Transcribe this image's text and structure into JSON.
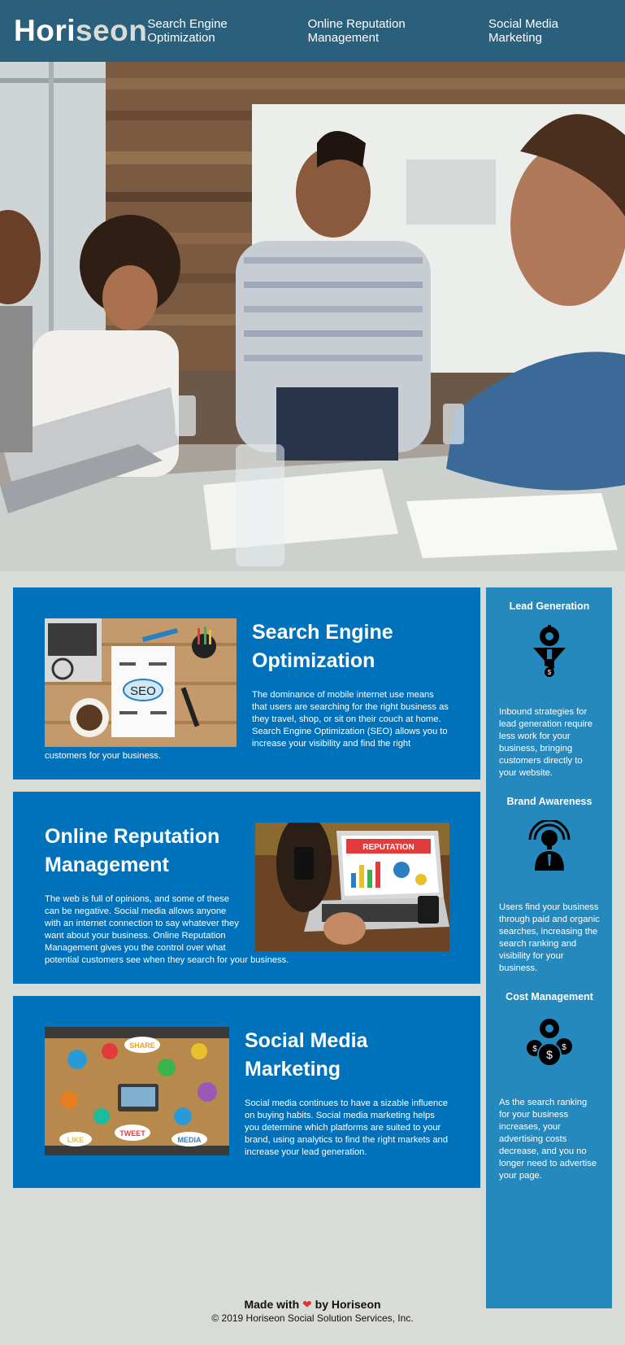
{
  "header": {
    "logo_main": "Hori",
    "logo_accent": "seon",
    "nav": [
      {
        "label": "Search Engine Optimization"
      },
      {
        "label": "Online Reputation Management"
      },
      {
        "label": "Social Media Marketing"
      }
    ]
  },
  "hero": {
    "image": "team-meeting-photo"
  },
  "content": [
    {
      "title": "Search Engine Optimization",
      "text": "The dominance of mobile internet use means that users are searching for the right business as they travel, shop, or sit on their couch at home. Search Engine Optimization (SEO) allows you to increase your visibility and find the right customers for your business.",
      "image": "seo-notebook-image",
      "image_text": "SEO"
    },
    {
      "title": "Online Reputation Management",
      "text": "The web is full of opinions, and some of these can be negative. Social media allows anyone with an internet connection to say whatever they want about your business. Online Reputation Management gives you the control over what potential customers see when they search for your business.",
      "image": "reputation-laptop-image",
      "image_text": "REPUTATION"
    },
    {
      "title": "Social Media Marketing",
      "text": "Social media continues to have a sizable influence on buying habits. Social media marketing helps you determine which platforms are suited to your brand, using analytics to find the right markets and increase your lead generation.",
      "image": "social-media-table-image",
      "image_labels": [
        "SHARE",
        "TWEET",
        "LIKE",
        "MEDIA"
      ]
    }
  ],
  "benefits": [
    {
      "title": "Lead Generation",
      "icon": "lead-generation-icon",
      "text": "Inbound strategies for lead generation require less work for your business, bringing customers directly to your website."
    },
    {
      "title": "Brand Awareness",
      "icon": "brand-awareness-icon",
      "text": "Users find your business through paid and organic searches, increasing the search ranking and visibility for your business."
    },
    {
      "title": "Cost Management",
      "icon": "cost-management-icon",
      "text": "As the search ranking for your business increases, your advertising costs decrease, and you no longer need to advertise your page."
    }
  ],
  "footer": {
    "made_with": "Made with",
    "by": "by Horiseon",
    "copyright": "© 2019 Horiseon Social Solution Services, Inc."
  },
  "colors": {
    "header_bg": "#2a607c",
    "card_bg": "#0072bb",
    "sidebar_bg": "#2589bd",
    "page_bg": "#d9dcd6",
    "heart": "#e63030"
  }
}
